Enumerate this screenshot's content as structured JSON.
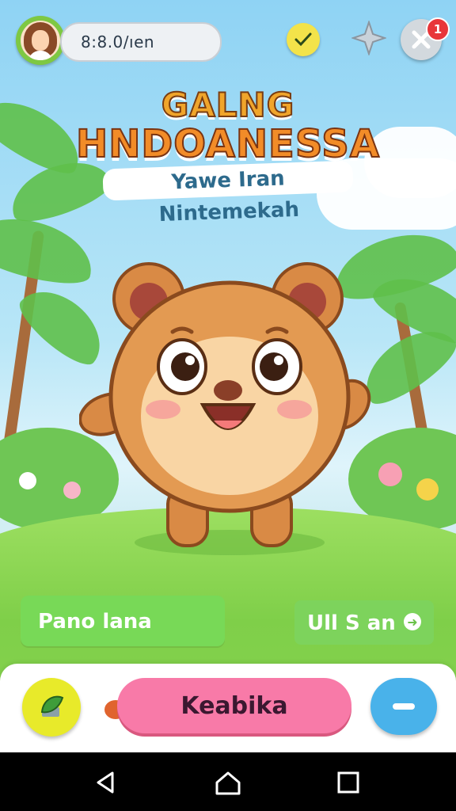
{
  "header": {
    "score": "8:8.0/ıen",
    "notification_count": "1"
  },
  "logo": {
    "line1": "GALNG",
    "line2": "HNDOANESSA",
    "subtitle": "Yawe Iran Nintemekah"
  },
  "panels": {
    "left_label": "Pano lana",
    "right_label": "Ull S an",
    "right_icon": "arrow-right-circle-icon"
  },
  "actions": {
    "leaf_icon": "leaf-icon",
    "food_icon": "chicken-leg-icon",
    "main_label": "Keabika",
    "minus_icon": "minus-icon"
  },
  "colors": {
    "accent_pink": "#f87aa8",
    "accent_green": "#78d957",
    "accent_blue": "#49b2ea",
    "accent_yellow": "#e8ea2a"
  }
}
